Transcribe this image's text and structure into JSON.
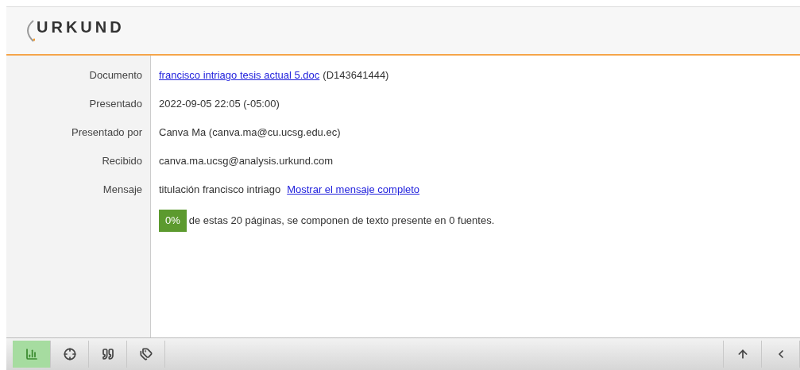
{
  "logo": {
    "text": "URKUND"
  },
  "fields": [
    {
      "label": "Documento",
      "kind": "link",
      "link": "francisco intriago tesis actual 5.doc",
      "text": "(D143641444)"
    },
    {
      "label": "Presentado",
      "kind": "text",
      "text": "2022-09-05 22:05 (-05:00)"
    },
    {
      "label": "Presentado por",
      "kind": "text",
      "text": "Canva Ma (canva.ma@cu.ucsg.edu.ec)"
    },
    {
      "label": "Recibido",
      "kind": "text",
      "text": "canva.ma.ucsg@analysis.urkund.com"
    },
    {
      "label": "Mensaje",
      "kind": "message",
      "text": "titulación francisco intriago",
      "link": "Mostrar el mensaje completo"
    }
  ],
  "summary": {
    "badge": "0%",
    "text": "de estas 20 páginas, se componen de texto presente en 0 fuentes."
  },
  "toolbar_left": [
    {
      "kind": "chart",
      "selected": true
    },
    {
      "kind": "crosshair",
      "selected": false
    },
    {
      "kind": "quote",
      "selected": false
    },
    {
      "kind": "tags",
      "selected": false
    }
  ],
  "toolbar_right": [
    {
      "kind": "up",
      "selected": false
    },
    {
      "kind": "left",
      "selected": false
    }
  ]
}
